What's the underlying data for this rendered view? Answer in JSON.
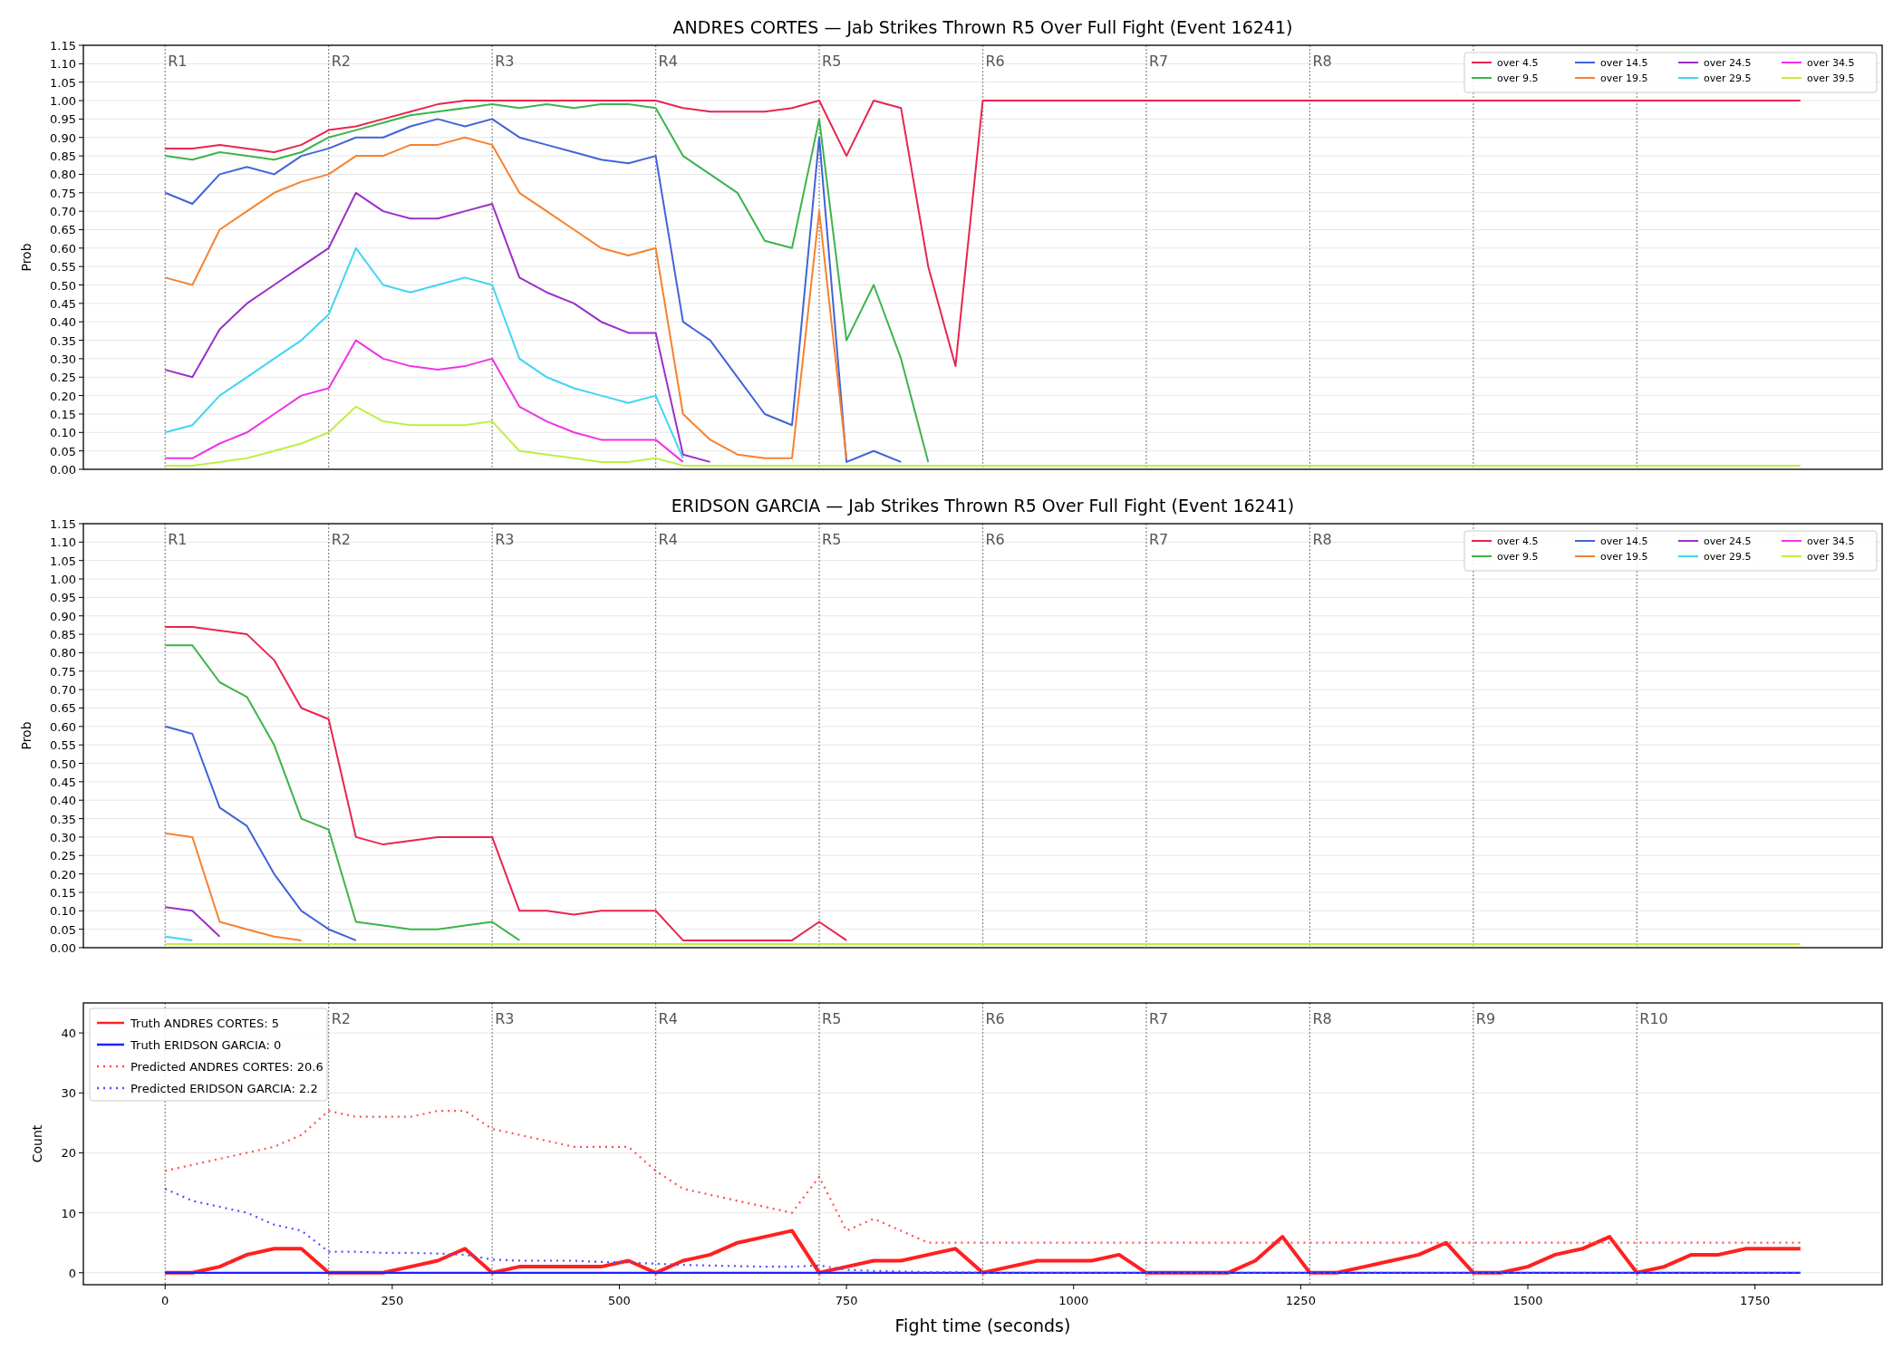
{
  "figure": {
    "panels": [
      {
        "chart_data": {
          "type": "line",
          "title": "ANDRES CORTES — Jab Strikes Thrown R5 Over Full Fight (Event 16241)",
          "ylabel": "Prob",
          "grid": true,
          "legend": "upper right",
          "x": [
            0,
            30,
            60,
            90,
            120,
            150,
            180,
            210,
            240,
            270,
            300,
            330,
            360,
            390,
            420,
            450,
            480,
            510,
            540,
            570,
            600,
            630,
            660,
            690,
            720,
            750,
            780,
            810,
            840,
            870,
            900,
            1800
          ],
          "xlim": [
            -90,
            1890
          ],
          "ylim": [
            0,
            1.15
          ],
          "yticks": [
            {
              "value": 0,
              "label": "0.00"
            },
            {
              "value": 0.05,
              "label": "0.05"
            },
            {
              "value": 0.1,
              "label": "0.10"
            },
            {
              "value": 0.15,
              "label": "0.15"
            },
            {
              "value": 0.2,
              "label": "0.20"
            },
            {
              "value": 0.25,
              "label": "0.25"
            },
            {
              "value": 0.3,
              "label": "0.30"
            },
            {
              "value": 0.35,
              "label": "0.35"
            },
            {
              "value": 0.4,
              "label": "0.40"
            },
            {
              "value": 0.45,
              "label": "0.45"
            },
            {
              "value": 0.5,
              "label": "0.50"
            },
            {
              "value": 0.55,
              "label": "0.55"
            },
            {
              "value": 0.6,
              "label": "0.60"
            },
            {
              "value": 0.65,
              "label": "0.65"
            },
            {
              "value": 0.7,
              "label": "0.70"
            },
            {
              "value": 0.75,
              "label": "0.75"
            },
            {
              "value": 0.8,
              "label": "0.80"
            },
            {
              "value": 0.85,
              "label": "0.85"
            },
            {
              "value": 0.9,
              "label": "0.90"
            },
            {
              "value": 0.95,
              "label": "0.95"
            },
            {
              "value": 1,
              "label": "1.00"
            },
            {
              "value": 1.05,
              "label": "1.05"
            },
            {
              "value": 1.1,
              "label": "1.10"
            },
            {
              "value": 1.15,
              "label": "1.15"
            }
          ],
          "ref_lines": [
            {
              "axis": "x",
              "value": 0,
              "label": "R1"
            },
            {
              "axis": "x",
              "value": 180,
              "label": "R2"
            },
            {
              "axis": "x",
              "value": 360,
              "label": "R3"
            },
            {
              "axis": "x",
              "value": 540,
              "label": "R4"
            },
            {
              "axis": "x",
              "value": 720,
              "label": "R5"
            },
            {
              "axis": "x",
              "value": 900,
              "label": "R6"
            },
            {
              "axis": "x",
              "value": 1080,
              "label": "R7"
            },
            {
              "axis": "x",
              "value": 1260,
              "label": "R8"
            },
            {
              "axis": "x",
              "value": 1440
            },
            {
              "axis": "x",
              "value": 1620
            }
          ],
          "series": [
            {
              "name": "over 4.5",
              "color": "#e8254f",
              "line_style": "solid",
              "values": [
                0.87,
                0.87,
                0.88,
                0.87,
                0.86,
                0.88,
                0.92,
                0.93,
                0.95,
                0.97,
                0.99,
                1,
                1,
                1,
                1,
                1,
                1,
                1,
                1,
                0.98,
                0.97,
                0.97,
                0.97,
                0.98,
                1,
                0.85,
                1,
                0.98,
                0.55,
                0.28,
                1,
                1
              ]
            },
            {
              "name": "over 9.5",
              "color": "#3cb44b",
              "line_style": "solid",
              "values": [
                0.85,
                0.84,
                0.86,
                0.85,
                0.84,
                0.86,
                0.9,
                0.92,
                0.94,
                0.96,
                0.97,
                0.98,
                0.99,
                0.98,
                0.99,
                0.98,
                0.99,
                0.99,
                0.98,
                0.85,
                0.8,
                0.75,
                0.62,
                0.6,
                0.95,
                0.35,
                0.5,
                0.3,
                0.02,
                null,
                null,
                null
              ]
            },
            {
              "name": "over 14.5",
              "color": "#4363d8",
              "line_style": "solid",
              "values": [
                0.75,
                0.72,
                0.8,
                0.82,
                0.8,
                0.85,
                0.87,
                0.9,
                0.9,
                0.93,
                0.95,
                0.93,
                0.95,
                0.9,
                0.88,
                0.86,
                0.84,
                0.83,
                0.85,
                0.4,
                0.35,
                0.25,
                0.15,
                0.12,
                0.9,
                0.02,
                0.05,
                0.02,
                null,
                null,
                null,
                null
              ]
            },
            {
              "name": "over 19.5",
              "color": "#f58231",
              "line_style": "solid",
              "values": [
                0.52,
                0.5,
                0.65,
                0.7,
                0.75,
                0.78,
                0.8,
                0.85,
                0.85,
                0.88,
                0.88,
                0.9,
                0.88,
                0.75,
                0.7,
                0.65,
                0.6,
                0.58,
                0.6,
                0.15,
                0.08,
                0.04,
                0.03,
                0.03,
                0.7,
                0.03,
                null,
                null,
                null,
                null,
                null,
                null
              ]
            },
            {
              "name": "over 24.5",
              "color": "#9b30c8",
              "line_style": "solid",
              "values": [
                0.27,
                0.25,
                0.38,
                0.45,
                0.5,
                0.55,
                0.6,
                0.75,
                0.7,
                0.68,
                0.68,
                0.7,
                0.72,
                0.52,
                0.48,
                0.45,
                0.4,
                0.37,
                0.37,
                0.04,
                0.02,
                null,
                null,
                null,
                null,
                null,
                null,
                null,
                null,
                null,
                null,
                null
              ]
            },
            {
              "name": "over 29.5",
              "color": "#42d4f4",
              "line_style": "solid",
              "values": [
                0.1,
                0.12,
                0.2,
                0.25,
                0.3,
                0.35,
                0.42,
                0.6,
                0.5,
                0.48,
                0.5,
                0.52,
                0.5,
                0.3,
                0.25,
                0.22,
                0.2,
                0.18,
                0.2,
                0.03,
                null,
                null,
                null,
                null,
                null,
                null,
                null,
                null,
                null,
                null,
                null,
                null
              ]
            },
            {
              "name": "over 34.5",
              "color": "#f032e6",
              "line_style": "solid",
              "values": [
                0.03,
                0.03,
                0.07,
                0.1,
                0.15,
                0.2,
                0.22,
                0.35,
                0.3,
                0.28,
                0.27,
                0.28,
                0.3,
                0.17,
                0.13,
                0.1,
                0.08,
                0.08,
                0.08,
                0.02,
                null,
                null,
                null,
                null,
                null,
                null,
                null,
                null,
                null,
                null,
                null,
                null
              ]
            },
            {
              "name": "over 39.5",
              "color": "#bfef45",
              "line_style": "solid",
              "values": [
                0.01,
                0.01,
                0.02,
                0.03,
                0.05,
                0.07,
                0.1,
                0.17,
                0.13,
                0.12,
                0.12,
                0.12,
                0.13,
                0.05,
                0.04,
                0.03,
                0.02,
                0.02,
                0.03,
                0.01,
                0.01,
                0.01,
                0.01,
                0.01,
                0.01,
                0.01,
                0.01,
                0.01,
                0.01,
                0.01,
                0.01,
                0.01
              ]
            }
          ]
        }
      },
      {
        "chart_data": {
          "type": "line",
          "title": "ERIDSON GARCIA — Jab Strikes Thrown R5 Over Full Fight (Event 16241)",
          "ylabel": "Prob",
          "grid": true,
          "legend": "upper right",
          "x": [
            0,
            30,
            60,
            90,
            120,
            150,
            180,
            210,
            240,
            270,
            300,
            330,
            360,
            390,
            420,
            450,
            480,
            510,
            540,
            570,
            600,
            630,
            660,
            690,
            720,
            750,
            780,
            810,
            840,
            870,
            900,
            1800
          ],
          "xlim": [
            -90,
            1890
          ],
          "ylim": [
            0,
            1.15
          ],
          "yticks": [
            {
              "value": 0,
              "label": "0.00"
            },
            {
              "value": 0.05,
              "label": "0.05"
            },
            {
              "value": 0.1,
              "label": "0.10"
            },
            {
              "value": 0.15,
              "label": "0.15"
            },
            {
              "value": 0.2,
              "label": "0.20"
            },
            {
              "value": 0.25,
              "label": "0.25"
            },
            {
              "value": 0.3,
              "label": "0.30"
            },
            {
              "value": 0.35,
              "label": "0.35"
            },
            {
              "value": 0.4,
              "label": "0.40"
            },
            {
              "value": 0.45,
              "label": "0.45"
            },
            {
              "value": 0.5,
              "label": "0.50"
            },
            {
              "value": 0.55,
              "label": "0.55"
            },
            {
              "value": 0.6,
              "label": "0.60"
            },
            {
              "value": 0.65,
              "label": "0.65"
            },
            {
              "value": 0.7,
              "label": "0.70"
            },
            {
              "value": 0.75,
              "label": "0.75"
            },
            {
              "value": 0.8,
              "label": "0.80"
            },
            {
              "value": 0.85,
              "label": "0.85"
            },
            {
              "value": 0.9,
              "label": "0.90"
            },
            {
              "value": 0.95,
              "label": "0.95"
            },
            {
              "value": 1,
              "label": "1.00"
            },
            {
              "value": 1.05,
              "label": "1.05"
            },
            {
              "value": 1.1,
              "label": "1.10"
            },
            {
              "value": 1.15,
              "label": "1.15"
            }
          ],
          "ref_lines": [
            {
              "axis": "x",
              "value": 0,
              "label": "R1"
            },
            {
              "axis": "x",
              "value": 180,
              "label": "R2"
            },
            {
              "axis": "x",
              "value": 360,
              "label": "R3"
            },
            {
              "axis": "x",
              "value": 540,
              "label": "R4"
            },
            {
              "axis": "x",
              "value": 720,
              "label": "R5"
            },
            {
              "axis": "x",
              "value": 900,
              "label": "R6"
            },
            {
              "axis": "x",
              "value": 1080,
              "label": "R7"
            },
            {
              "axis": "x",
              "value": 1260,
              "label": "R8"
            },
            {
              "axis": "x",
              "value": 1440
            },
            {
              "axis": "x",
              "value": 1620
            }
          ],
          "series": [
            {
              "name": "over 4.5",
              "color": "#e8254f",
              "line_style": "solid",
              "values": [
                0.87,
                0.87,
                0.86,
                0.85,
                0.78,
                0.65,
                0.62,
                0.3,
                0.28,
                0.29,
                0.3,
                0.3,
                0.3,
                0.1,
                0.1,
                0.09,
                0.1,
                0.1,
                0.1,
                0.02,
                0.02,
                0.02,
                0.02,
                0.02,
                0.07,
                0.02,
                null,
                null,
                null,
                null,
                null,
                null
              ]
            },
            {
              "name": "over 9.5",
              "color": "#3cb44b",
              "line_style": "solid",
              "values": [
                0.82,
                0.82,
                0.72,
                0.68,
                0.55,
                0.35,
                0.32,
                0.07,
                0.06,
                0.05,
                0.05,
                0.06,
                0.07,
                0.02,
                null,
                null,
                null,
                null,
                null,
                null,
                null,
                null,
                null,
                null,
                null,
                null,
                null,
                null,
                null,
                null,
                null,
                null
              ]
            },
            {
              "name": "over 14.5",
              "color": "#4363d8",
              "line_style": "solid",
              "values": [
                0.6,
                0.58,
                0.38,
                0.33,
                0.2,
                0.1,
                0.05,
                0.02,
                null,
                null,
                null,
                null,
                null,
                null,
                null,
                null,
                null,
                null,
                null,
                null,
                null,
                null,
                null,
                null,
                null,
                null,
                null,
                null,
                null,
                null,
                null,
                null
              ]
            },
            {
              "name": "over 19.5",
              "color": "#f58231",
              "line_style": "solid",
              "values": [
                0.31,
                0.3,
                0.07,
                0.05,
                0.03,
                0.02,
                null,
                null,
                null,
                null,
                null,
                null,
                null,
                null,
                null,
                null,
                null,
                null,
                null,
                null,
                null,
                null,
                null,
                null,
                null,
                null,
                null,
                null,
                null,
                null,
                null,
                null
              ]
            },
            {
              "name": "over 24.5",
              "color": "#9b30c8",
              "line_style": "solid",
              "values": [
                0.11,
                0.1,
                0.03,
                null,
                null,
                null,
                null,
                null,
                null,
                null,
                null,
                null,
                null,
                null,
                null,
                null,
                null,
                null,
                null,
                null,
                null,
                null,
                null,
                null,
                null,
                null,
                null,
                null,
                null,
                null,
                null,
                null
              ]
            },
            {
              "name": "over 29.5",
              "color": "#42d4f4",
              "line_style": "solid",
              "values": [
                0.03,
                0.02,
                null,
                null,
                null,
                null,
                null,
                null,
                null,
                null,
                null,
                null,
                null,
                null,
                null,
                null,
                null,
                null,
                null,
                null,
                null,
                null,
                null,
                null,
                null,
                null,
                null,
                null,
                null,
                null,
                null,
                null
              ]
            },
            {
              "name": "over 34.5",
              "color": "#f032e6",
              "line_style": "solid",
              "values": [
                null,
                null,
                null,
                null,
                null,
                null,
                null,
                null,
                null,
                null,
                null,
                null,
                null,
                null,
                null,
                null,
                null,
                null,
                null,
                null,
                null,
                null,
                null,
                null,
                null,
                null,
                null,
                null,
                null,
                null,
                null,
                null
              ]
            },
            {
              "name": "over 39.5",
              "color": "#bfef45",
              "line_style": "solid",
              "values": [
                0.01,
                0.01,
                0.01,
                0.01,
                0.01,
                0.01,
                0.01,
                0.01,
                0.01,
                0.01,
                0.01,
                0.01,
                0.01,
                0.01,
                0.01,
                0.01,
                0.01,
                0.01,
                0.01,
                0.01,
                0.01,
                0.01,
                0.01,
                0.01,
                0.01,
                0.01,
                0.01,
                0.01,
                0.01,
                0.01,
                0.01,
                0.01
              ]
            }
          ]
        }
      },
      {
        "chart_data": {
          "type": "line",
          "xlabel": "Fight time (seconds)",
          "ylabel": "Count",
          "grid": true,
          "legend": "upper left",
          "x": [
            0,
            30,
            60,
            90,
            120,
            150,
            180,
            210,
            240,
            270,
            300,
            330,
            360,
            390,
            420,
            450,
            480,
            510,
            540,
            570,
            600,
            630,
            660,
            690,
            720,
            750,
            780,
            810,
            840,
            870,
            900,
            930,
            960,
            990,
            1020,
            1050,
            1080,
            1110,
            1140,
            1170,
            1200,
            1230,
            1260,
            1290,
            1320,
            1350,
            1380,
            1410,
            1440,
            1470,
            1500,
            1530,
            1560,
            1590,
            1620,
            1650,
            1680,
            1710,
            1740,
            1770,
            1800
          ],
          "xlim": [
            -90,
            1890
          ],
          "ylim": [
            -2,
            45
          ],
          "xticks": [
            0,
            250,
            500,
            750,
            1000,
            1250,
            1500,
            1750
          ],
          "yticks": [
            0,
            10,
            20,
            30,
            40
          ],
          "ref_lines": [
            {
              "axis": "x",
              "value": 0
            },
            {
              "axis": "x",
              "value": 180,
              "label": "R2"
            },
            {
              "axis": "x",
              "value": 360,
              "label": "R3"
            },
            {
              "axis": "x",
              "value": 540,
              "label": "R4"
            },
            {
              "axis": "x",
              "value": 720,
              "label": "R5"
            },
            {
              "axis": "x",
              "value": 900,
              "label": "R6"
            },
            {
              "axis": "x",
              "value": 1080,
              "label": "R7"
            },
            {
              "axis": "x",
              "value": 1260,
              "label": "R8"
            },
            {
              "axis": "x",
              "value": 1440,
              "label": "R9"
            },
            {
              "axis": "x",
              "value": 1620,
              "label": "R10"
            }
          ],
          "series": [
            {
              "name": "Truth ANDRES CORTES: 5",
              "color": "#ff2020",
              "line_style": "solid",
              "values": [
                0,
                0,
                1,
                3,
                4,
                4,
                0,
                0,
                0,
                1,
                2,
                4,
                0,
                1,
                1,
                1,
                1,
                2,
                0,
                2,
                3,
                5,
                6,
                7,
                0,
                1,
                2,
                2,
                3,
                4,
                0,
                1,
                2,
                2,
                2,
                3,
                0,
                0,
                0,
                0,
                2,
                6,
                0,
                0,
                1,
                2,
                3,
                5,
                0,
                0,
                1,
                3,
                4,
                6,
                0,
                1,
                3,
                3,
                4,
                4,
                4
              ]
            },
            {
              "name": "Truth ERIDSON GARCIA: 0",
              "color": "#2020ff",
              "line_style": "solid",
              "values": [
                0,
                0,
                0,
                0,
                0,
                0,
                0,
                0,
                0,
                0,
                0,
                0,
                0,
                0,
                0,
                0,
                0,
                0,
                0,
                0,
                0,
                0,
                0,
                0,
                0,
                0,
                0,
                0,
                0,
                0,
                0,
                0,
                0,
                0,
                0,
                0,
                0,
                0,
                0,
                0,
                0,
                0,
                0,
                0,
                0,
                0,
                0,
                0,
                0,
                0,
                0,
                0,
                0,
                0,
                0,
                0,
                0,
                0,
                0,
                0,
                0
              ]
            },
            {
              "name": "Predicted ANDRES CORTES: 20.6",
              "color": "#ff5050",
              "line_style": "dotted",
              "values": [
                17,
                18,
                19,
                20,
                21,
                23,
                27,
                26,
                26,
                26,
                27,
                27,
                24,
                23,
                22,
                21,
                21,
                21,
                17,
                14,
                13,
                12,
                11,
                10,
                16,
                7,
                9,
                7,
                5,
                5,
                5,
                5,
                5,
                5,
                5,
                5,
                5,
                5,
                5,
                5,
                5,
                5,
                5,
                5,
                5,
                5,
                5,
                5,
                5,
                5,
                5,
                5,
                5,
                5,
                5,
                5,
                5,
                5,
                5,
                5,
                5
              ]
            },
            {
              "name": "Predicted ERIDSON GARCIA: 2.2",
              "color": "#5050ff",
              "line_style": "dotted",
              "values": [
                14,
                12,
                11,
                10,
                8,
                7,
                3.5,
                3.5,
                3.3,
                3.3,
                3.2,
                3,
                2.2,
                2,
                2,
                2,
                1.8,
                1.7,
                1.5,
                1.3,
                1.2,
                1.1,
                1,
                1,
                1.2,
                0.5,
                0.3,
                0.2,
                0.1,
                0.1,
                0,
                0,
                0,
                0,
                0,
                0,
                0,
                0,
                0,
                0,
                0,
                0,
                0,
                0,
                0,
                0,
                0,
                0,
                0,
                0,
                0,
                0,
                0,
                0,
                0,
                0,
                0,
                0,
                0,
                0,
                0
              ]
            }
          ]
        }
      }
    ]
  }
}
